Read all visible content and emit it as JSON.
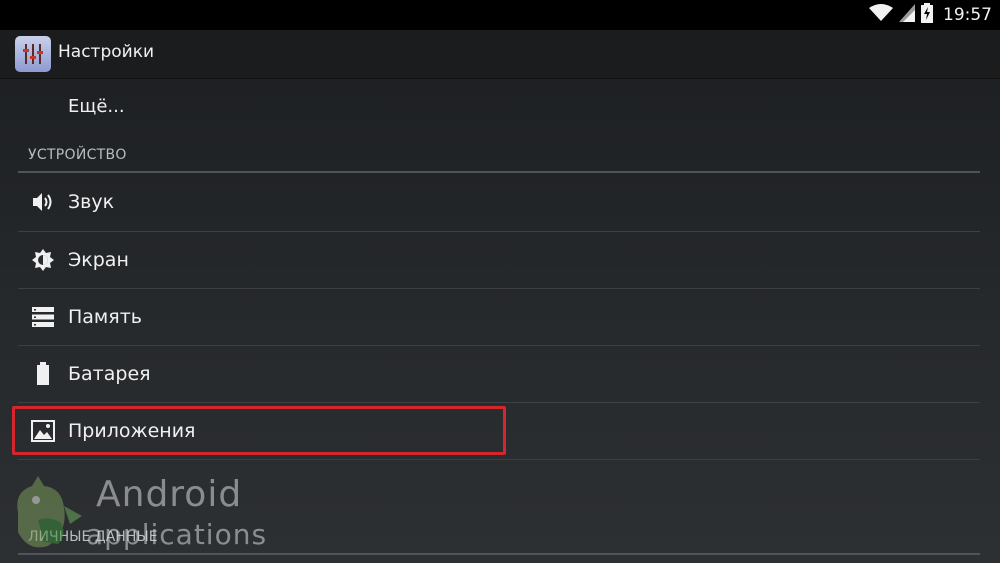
{
  "status_bar": {
    "time": "19:57",
    "icons": [
      "wifi-icon",
      "signal-icon",
      "battery-charging-icon"
    ]
  },
  "action_bar": {
    "title": "Настройки",
    "icon": "settings-sliders-icon"
  },
  "list": {
    "more_item": "Ещё...",
    "device_section": {
      "header": "УСТРОЙСТВО",
      "items": [
        {
          "label": "Звук",
          "icon": "speaker-icon"
        },
        {
          "label": "Экран",
          "icon": "brightness-icon"
        },
        {
          "label": "Память",
          "icon": "storage-icon"
        },
        {
          "label": "Батарея",
          "icon": "battery-icon"
        },
        {
          "label": "Приложения",
          "icon": "apps-icon"
        }
      ]
    },
    "personal_section": {
      "header": "ЛИЧНЫЕ ДАННЫЕ"
    }
  },
  "highlight": {
    "color": "#d4262c"
  },
  "watermark": {
    "line1": "Android",
    "line2": "applications"
  }
}
